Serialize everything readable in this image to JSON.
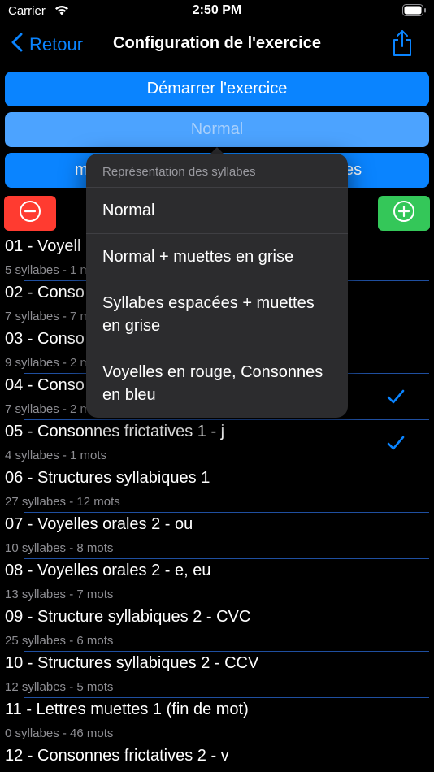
{
  "status_bar": {
    "carrier": "Carrier",
    "time": "2:50 PM"
  },
  "nav": {
    "back_label": "Retour",
    "title": "Configuration de l'exercice"
  },
  "buttons": {
    "start": "Démarrer l'exercice",
    "mode": "Normal",
    "third_left": "m",
    "third_right": "es"
  },
  "menu": {
    "header": "Représentation des syllabes",
    "items": [
      {
        "label": "Normal"
      },
      {
        "label": "Normal + muettes en grise"
      },
      {
        "label": "Syllabes espacées + muettes en grise"
      },
      {
        "label": "Voyelles en rouge, Consonnes en bleu"
      }
    ]
  },
  "list": [
    {
      "title": "01 - Voyell",
      "subtitle": "5 syllabes - 1 m",
      "checked": false
    },
    {
      "title": "02 - Conso",
      "subtitle": "7 syllabes - 7 m",
      "checked": false
    },
    {
      "title": "03 - Conso",
      "subtitle": "9 syllabes - 2 m",
      "checked": false
    },
    {
      "title": "04 - Conso",
      "subtitle": "7 syllabes - 2 m",
      "checked": true
    },
    {
      "title": "05 - Consonnes frictatives 1 - j",
      "subtitle": "4 syllabes - 1 mots",
      "checked": true
    },
    {
      "title": "06 - Structures syllabiques 1",
      "subtitle": "27 syllabes - 12 mots",
      "checked": false
    },
    {
      "title": "07 - Voyelles orales 2 - ou",
      "subtitle": "10 syllabes - 8 mots",
      "checked": false
    },
    {
      "title": "08 - Voyelles orales 2 - e, eu",
      "subtitle": "13 syllabes - 7 mots",
      "checked": false
    },
    {
      "title": "09 - Structure syllabiques 2 - CVC",
      "subtitle": "25 syllabes - 6 mots",
      "checked": false
    },
    {
      "title": "10 - Structures syllabiques 2 - CCV",
      "subtitle": "12 syllabes - 5 mots",
      "checked": false
    },
    {
      "title": "11 - Lettres muettes 1 (fin de mot)",
      "subtitle": "0 syllabes - 46 mots",
      "checked": false
    },
    {
      "title": "12 - Consonnes frictatives 2 - v",
      "subtitle": "",
      "checked": false
    }
  ],
  "colors": {
    "accent": "#0a84ff",
    "remove": "#ff3b30",
    "add": "#34c759",
    "separator": "#1f4fa0"
  },
  "icons": [
    "wifi-icon",
    "battery-icon",
    "chevron-left-icon",
    "share-icon",
    "minus-circle-icon",
    "plus-circle-icon",
    "checkmark-icon"
  ]
}
